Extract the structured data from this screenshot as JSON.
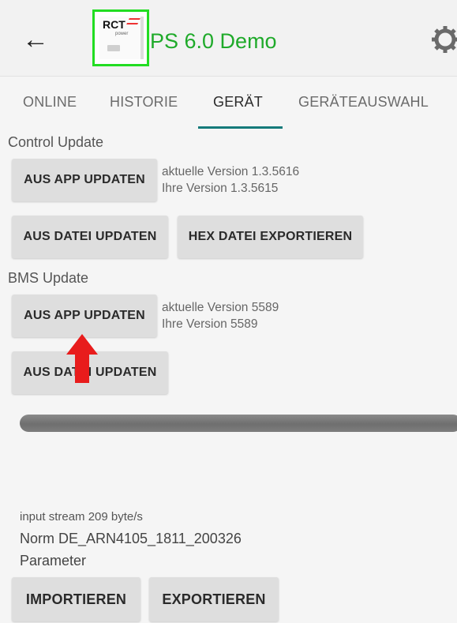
{
  "appbar": {
    "back_icon": "arrow-left-icon",
    "logo": {
      "brand": "RCT",
      "sub": "power"
    },
    "title": "PS 6.0 Demo",
    "title_color": "#1faa2a",
    "settings_icon": "gear-icon"
  },
  "tabs": {
    "items": [
      {
        "label": "ONLINE"
      },
      {
        "label": "HISTORIE"
      },
      {
        "label": "GERÄT",
        "active": true
      },
      {
        "label": "GERÄTEAUSWAHL"
      }
    ],
    "indicator_color": "#147a7a"
  },
  "control_update": {
    "heading": "Control Update",
    "app_update_label": "AUS APP UPDATEN",
    "current_version": "aktuelle Version 1.3.5616",
    "your_version": "Ihre Version 1.3.5615",
    "file_update_label": "AUS DATEI UPDATEN",
    "hex_export_label": "HEX DATEI EXPORTIEREN"
  },
  "bms_update": {
    "heading": "BMS Update",
    "app_update_label": "AUS APP UPDATEN",
    "current_version": "aktuelle Version 5589",
    "your_version": "Ihre Version 5589",
    "file_update_label": "AUS DATEI UPDATEN"
  },
  "annotation": {
    "icon": "red-arrow-up-icon",
    "color": "#e81c1c"
  },
  "status": {
    "input_stream": "input stream 209 byte/s",
    "norm": "Norm DE_ARN4105_1811_200326",
    "parameter": "Parameter"
  },
  "parameter_actions": {
    "import_label": "IMPORTIEREN",
    "export_label": "EXPORTIEREN"
  }
}
